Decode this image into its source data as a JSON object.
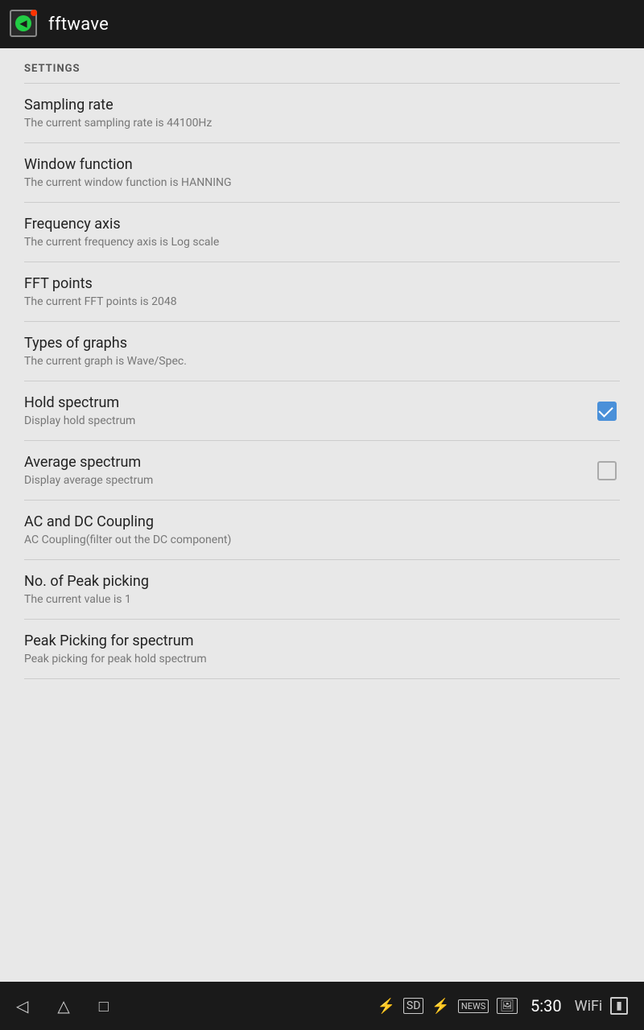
{
  "app": {
    "title": "fftwave",
    "logo_alt": "fftwave app icon"
  },
  "settings_header": "SETTINGS",
  "settings": [
    {
      "id": "sampling-rate",
      "title": "Sampling rate",
      "subtitle": "The current sampling rate is 44100Hz",
      "has_checkbox": false
    },
    {
      "id": "window-function",
      "title": "Window function",
      "subtitle": "The current window function is HANNING",
      "has_checkbox": false
    },
    {
      "id": "frequency-axis",
      "title": "Frequency axis",
      "subtitle": "The current frequency axis is Log scale",
      "has_checkbox": false
    },
    {
      "id": "fft-points",
      "title": "FFT points",
      "subtitle": "The current FFT points is 2048",
      "has_checkbox": false
    },
    {
      "id": "types-of-graphs",
      "title": "Types of graphs",
      "subtitle": "The current graph is Wave/Spec.",
      "has_checkbox": false
    },
    {
      "id": "hold-spectrum",
      "title": "Hold spectrum",
      "subtitle": "Display hold spectrum",
      "has_checkbox": true,
      "checked": true
    },
    {
      "id": "average-spectrum",
      "title": "Average spectrum",
      "subtitle": "Display average spectrum",
      "has_checkbox": true,
      "checked": false
    },
    {
      "id": "ac-dc-coupling",
      "title": "AC and DC Coupling",
      "subtitle": "AC Coupling(filter out the DC component)",
      "has_checkbox": false
    },
    {
      "id": "peak-picking",
      "title": "No. of Peak picking",
      "subtitle": "The current value is 1",
      "has_checkbox": false
    },
    {
      "id": "peak-picking-spectrum",
      "title": "Peak Picking for spectrum",
      "subtitle": "Peak picking for peak hold spectrum",
      "has_checkbox": false
    }
  ],
  "bottombar": {
    "time": "5:30",
    "nav_back": "◁",
    "nav_home": "△",
    "nav_recent": "□"
  }
}
